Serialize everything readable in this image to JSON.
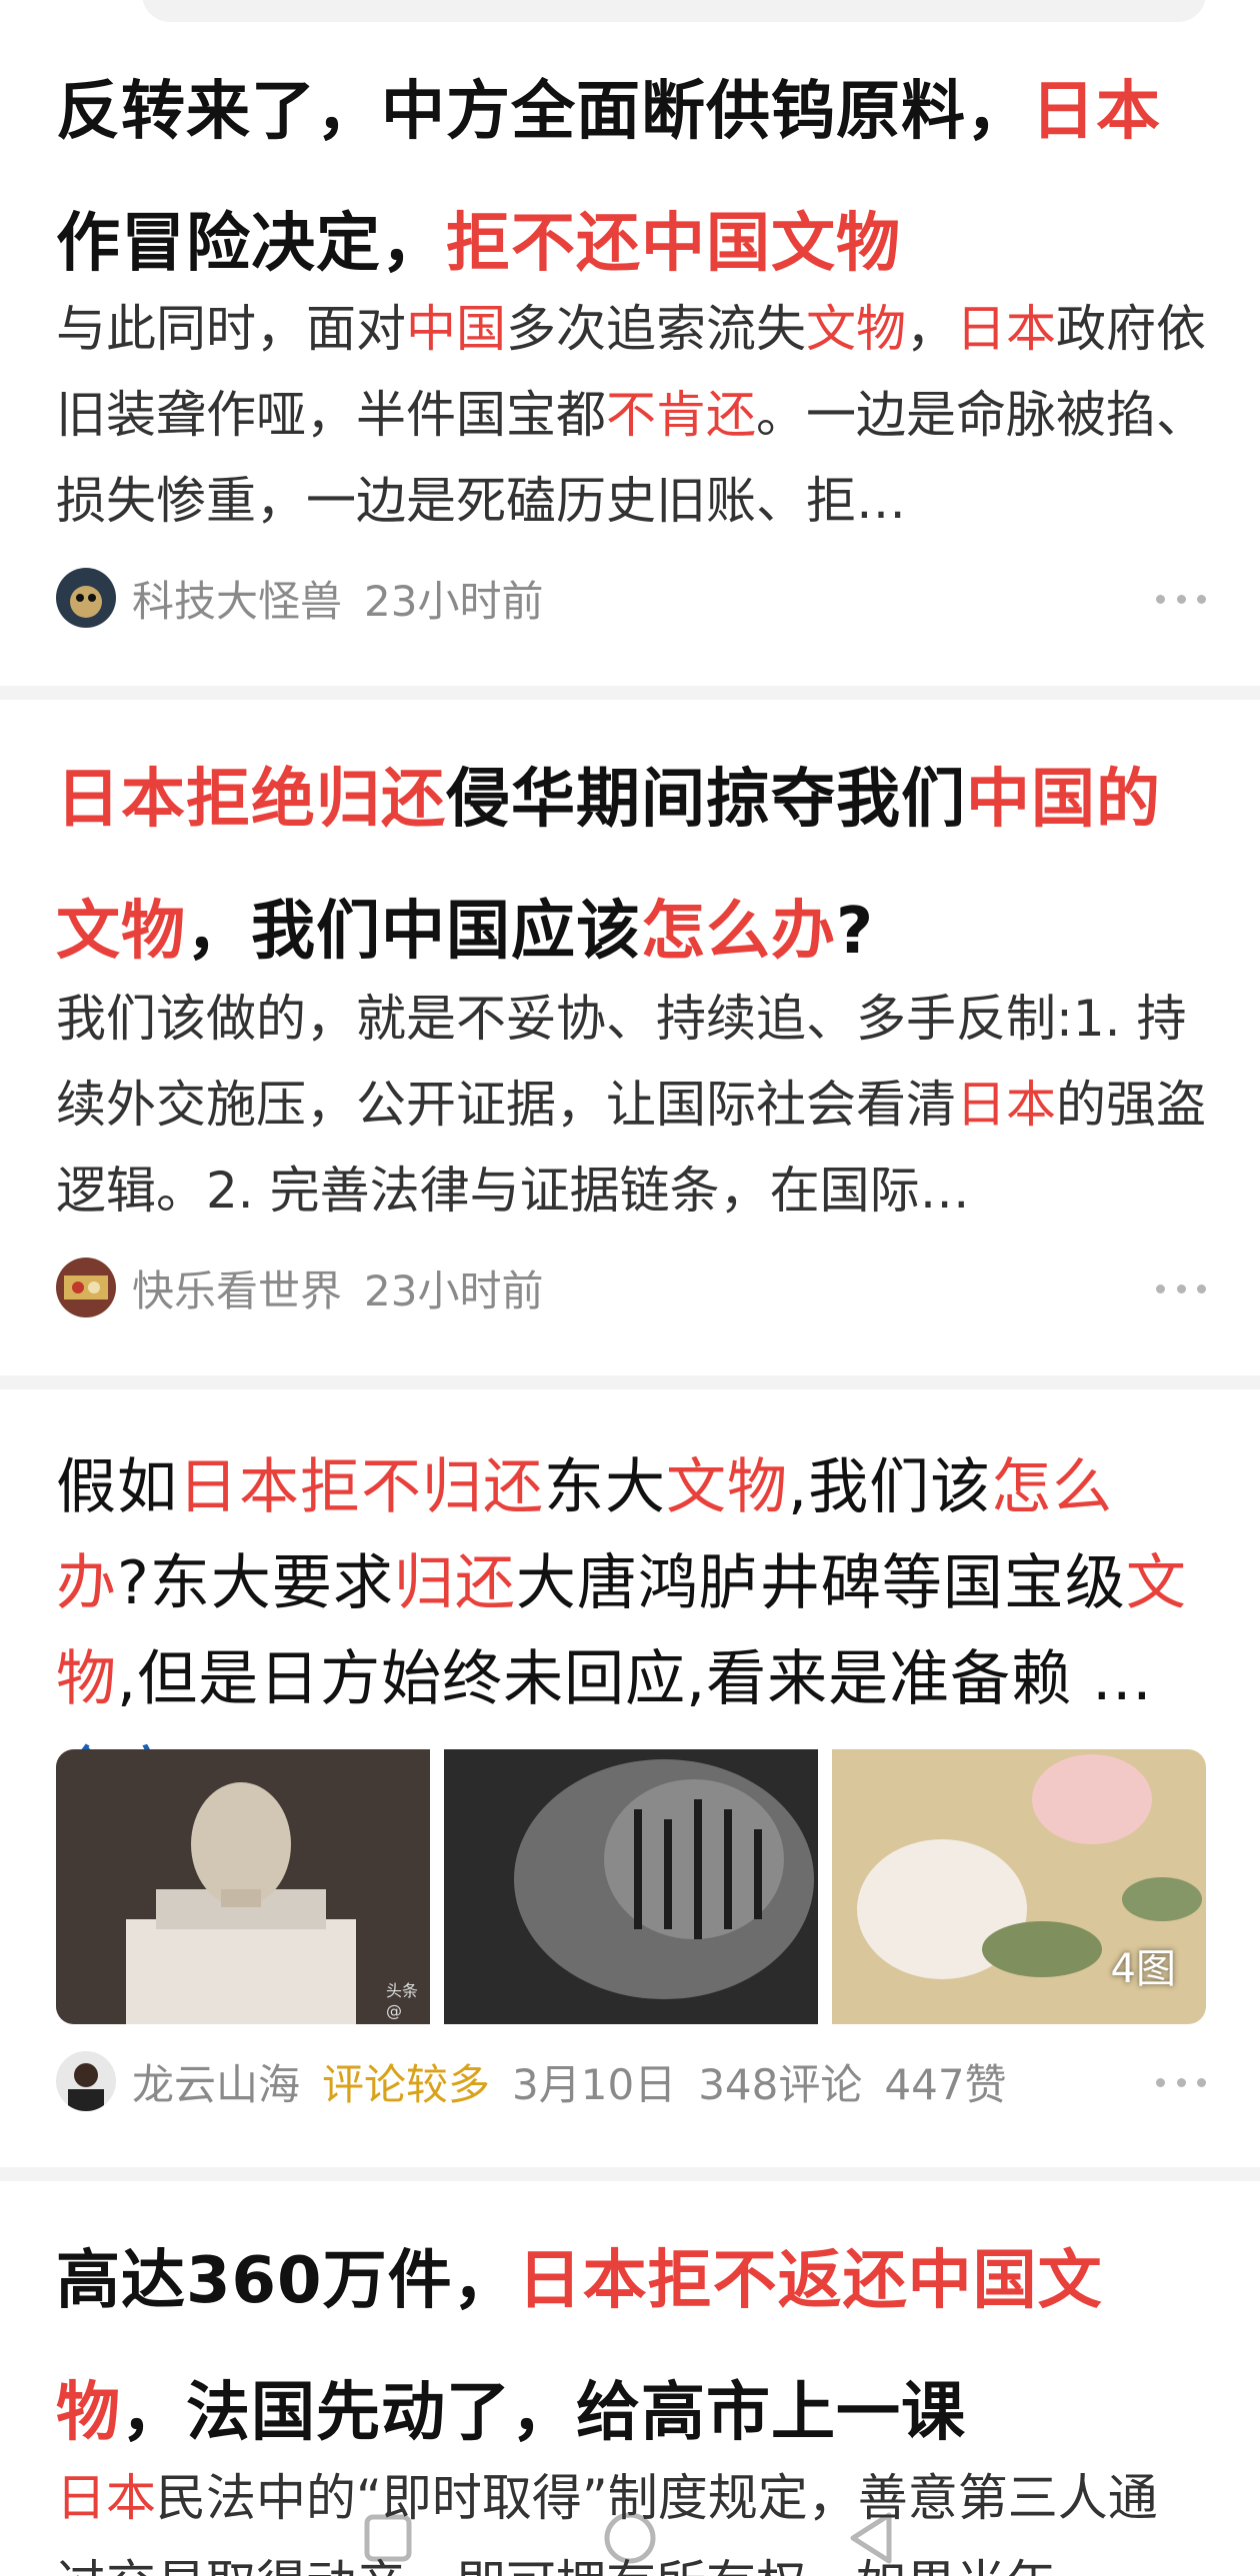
{
  "colors": {
    "highlight": "#e8413b",
    "hot_tag": "#d9a21b",
    "link": "#1a5fb4",
    "meta_gray": "#8a8a8a"
  },
  "articles": [
    {
      "title_parts": [
        "反转来了，中方全面断供钨原料，",
        "日本",
        "作冒险决定，",
        "拒不还中国文物"
      ],
      "snippet_parts": [
        "与此同时，面对",
        "中国",
        "多次追索流失",
        "文物",
        "，",
        "日本",
        "政府依旧装聋作哑，半件国宝都",
        "不肯还",
        "。一边是命脉被掐、损失惨重，一边是死磕历史旧账、拒…"
      ],
      "author": "科技大怪兽",
      "time": "23小时前"
    },
    {
      "title_parts": [
        "日本拒绝归还",
        "侵华期间掠夺我们",
        "中国的文物",
        "，我们中国应该",
        "怎么办",
        "?"
      ],
      "snippet_parts": [
        "我们该做的，就是不妥协、持续追、多手反制:1. 持续外交施压，公开证据，让国际社会看清",
        "日本",
        "的强盗逻辑。2. 完善法律与证据链条，在国际…"
      ],
      "author": "快乐看世界",
      "time": "23小时前"
    },
    {
      "title_parts": [
        "假如",
        "日本拒不归还",
        "东大",
        "文物",
        ",我们该",
        "怎么办",
        "?东大要求",
        "归还",
        "大唐鸿胪井碑等国宝级",
        "文物",
        ",但是日方始终未回应,看来是准备赖 "
      ],
      "more_label": "...",
      "fulltext_label": "全文",
      "image_count": "4图",
      "watermark": "头条@",
      "author": "龙云山海",
      "tag": "评论较多",
      "date": "3月10日",
      "comments": "348评论",
      "likes": "447赞"
    },
    {
      "title_parts": [
        "高达360万件，",
        "日本拒不返还中国文物",
        "，法国先动了，给高市上一课"
      ],
      "snippet_parts": [
        "日本",
        "民法中的“即时取得”制度规定，善意第三人通过交易取得动产，即可拥有所有权，如果当年"
      ]
    }
  ]
}
